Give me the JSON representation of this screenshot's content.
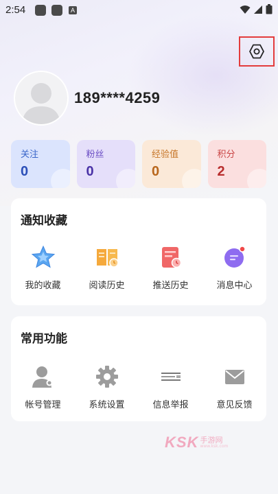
{
  "status_bar": {
    "time": "2:54",
    "notif_icon_a": "A"
  },
  "profile": {
    "phone": "189****4259"
  },
  "stats": [
    {
      "label": "关注",
      "value": "0",
      "bg": "#dbe4fd",
      "label_color": "#3a66c9",
      "value_color": "#2b4fb8"
    },
    {
      "label": "粉丝",
      "value": "0",
      "bg": "#e5dffa",
      "label_color": "#6a4cc4",
      "value_color": "#4a32a6"
    },
    {
      "label": "经验值",
      "value": "0",
      "bg": "#fbe9d8",
      "label_color": "#c7772a",
      "value_color": "#b8661c"
    },
    {
      "label": "积分",
      "value": "2",
      "bg": "#fbdfdf",
      "label_color": "#c94444",
      "value_color": "#b82d2d"
    }
  ],
  "notify_section": {
    "title": "通知收藏",
    "items": [
      {
        "label": "我的收藏",
        "icon": "star-icon"
      },
      {
        "label": "阅读历史",
        "icon": "book-icon"
      },
      {
        "label": "推送历史",
        "icon": "push-history-icon"
      },
      {
        "label": "消息中心",
        "icon": "message-icon"
      }
    ]
  },
  "common_section": {
    "title": "常用功能",
    "items": [
      {
        "label": "帐号管理",
        "icon": "user-icon"
      },
      {
        "label": "系统设置",
        "icon": "gear-icon"
      },
      {
        "label": "信息举报",
        "icon": "report-icon"
      },
      {
        "label": "意见反馈",
        "icon": "mail-icon"
      }
    ]
  },
  "watermark": {
    "letters": "KSK",
    "text": "手游网",
    "sub": "www.ksk.com"
  }
}
